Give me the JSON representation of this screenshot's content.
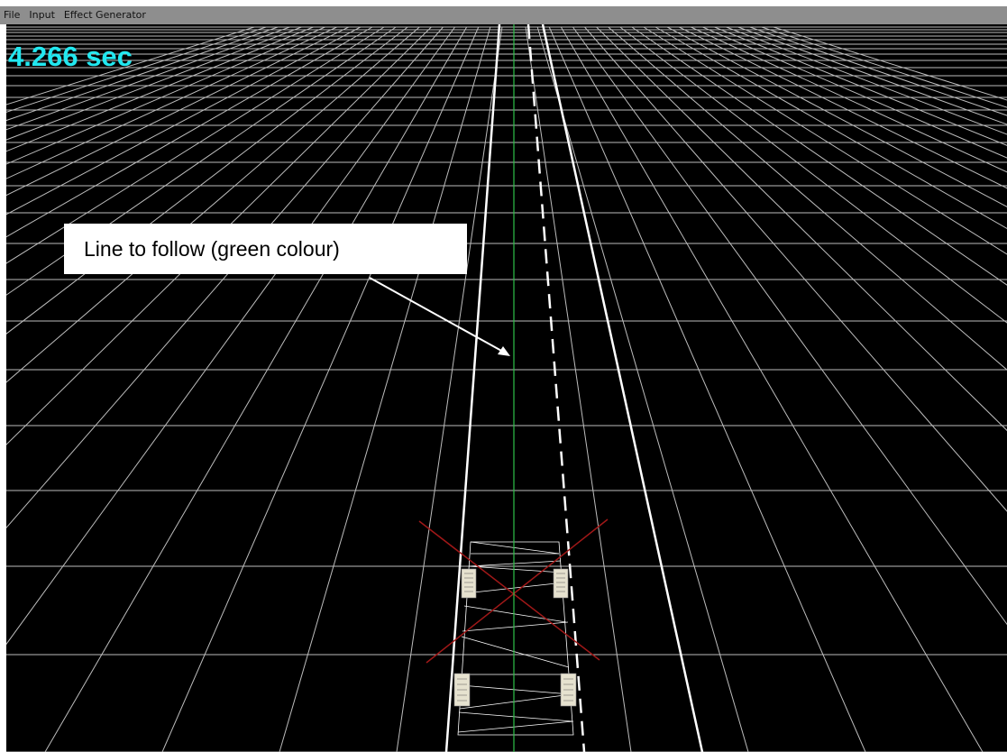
{
  "menubar": {
    "items": [
      "File",
      "Input",
      "Effect Generator"
    ]
  },
  "viewport": {
    "timer_text": "4.266 sec",
    "annotation": "Line to follow (green colour)",
    "colors": {
      "background": "#000000",
      "grid": "#bdbdbd",
      "guide_line": "#2fc04a",
      "timer": "#22e8f0",
      "cross": "#a01818",
      "lane_lines": "#ffffff"
    }
  }
}
